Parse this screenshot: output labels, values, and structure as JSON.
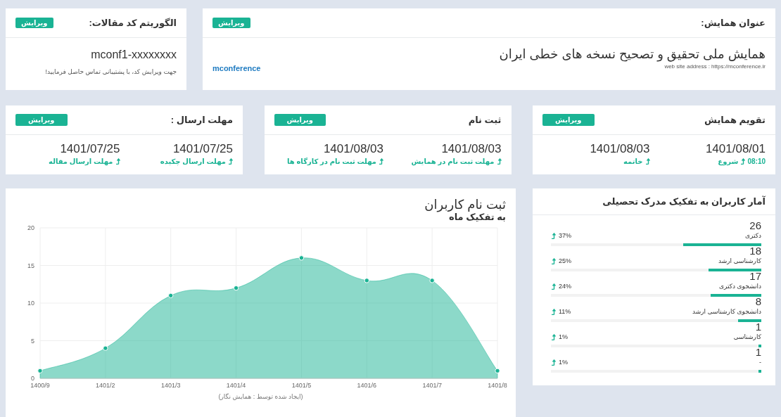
{
  "conference": {
    "heading": "عنوان همایش:",
    "edit": "ویرایش",
    "title": "همایش ملی تحقیق و تصحیح نسخه های خطی ایران",
    "website": "web site address : https://mconference.ir",
    "brand": "mconference"
  },
  "algorithm": {
    "heading": "الگوریتم کد مقالات:",
    "edit": "ویرایش",
    "code": "mconf1-xxxxxxxx",
    "note": "جهت ویرایش کد، با پشتیبانی تماس حاصل فرمایید!"
  },
  "date_cards": [
    {
      "heading": "تقویم همایش",
      "edit": "ویرایش",
      "items": [
        {
          "date": "1401/08/01",
          "time": "08:10",
          "label": "شروع"
        },
        {
          "date": "1401/08/03",
          "label": "خاتمه"
        }
      ]
    },
    {
      "heading": "ثبت نام",
      "edit": "ویرایش",
      "items": [
        {
          "date": "1401/08/03",
          "label": "مهلت ثبت نام در همایش"
        },
        {
          "date": "1401/08/03",
          "label": "مهلت ثبت نام در کارگاه ها"
        }
      ]
    },
    {
      "heading": "مهلت ارسال :",
      "edit": "ویرایش",
      "items": [
        {
          "date": "1401/07/25",
          "label": "مهلت ارسال چکیده"
        },
        {
          "date": "1401/07/25",
          "label": "مهلت ارسال مقاله"
        }
      ]
    }
  ],
  "stats": {
    "title": "آمار کاربران به تفکیک مدرک تحصیلی",
    "rows": [
      {
        "count": "26",
        "label": "دکتری",
        "percent": "37%",
        "level": 0.37
      },
      {
        "count": "18",
        "label": "کارشناسی ارشد",
        "percent": "25%",
        "level": 0.25
      },
      {
        "count": "17",
        "label": "دانشجوی دکتری",
        "percent": "24%",
        "level": 0.24
      },
      {
        "count": "8",
        "label": "دانشجوی کارشناسی ارشد",
        "percent": "11%",
        "level": 0.11
      },
      {
        "count": "1",
        "label": "کارشناسی",
        "percent": "1%",
        "level": 0.01
      },
      {
        "count": "1",
        "label": "-",
        "percent": "1%",
        "level": 0.01
      }
    ]
  },
  "registrations": {
    "title": "ثبت نام کاربران",
    "subtitle": "به تفکیک ماه",
    "credit": "(ایجاد شده توسط : همایش نگار)",
    "chart_data": {
      "type": "area",
      "categories": [
        "1400/9",
        "1401/2",
        "1401/3",
        "1401/4",
        "1401/5",
        "1401/6",
        "1401/7",
        "1401/8"
      ],
      "series": [
        {
          "color": "#1ab394",
          "values": [
            1,
            4,
            11,
            12,
            16,
            13,
            13,
            1
          ]
        }
      ],
      "ylim": [
        0,
        20
      ],
      "yticks": [
        0,
        5,
        10,
        15,
        20
      ],
      "grid": true
    }
  }
}
